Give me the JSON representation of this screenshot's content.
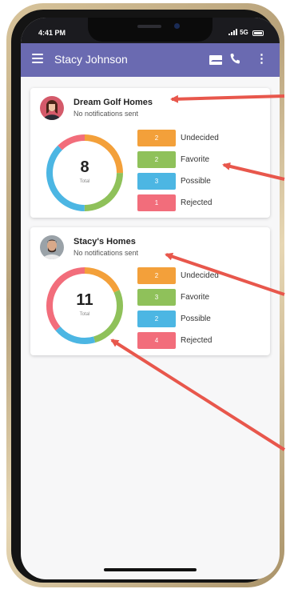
{
  "status_bar": {
    "time": "4:41 PM",
    "network": "5G"
  },
  "app_bar": {
    "title": "Stacy Johnson",
    "icons": [
      "menu-icon",
      "mail-icon",
      "phone-icon",
      "more-vert-icon"
    ]
  },
  "cards": [
    {
      "title": "Dream Golf Homes",
      "notification": "No notifications sent",
      "total": "8",
      "total_label": "Total",
      "statuses": [
        {
          "count": "2",
          "label": "Undecided",
          "color": "#f3a03a"
        },
        {
          "count": "2",
          "label": "Favorite",
          "color": "#8fc15a"
        },
        {
          "count": "3",
          "label": "Possible",
          "color": "#4cb6e3"
        },
        {
          "count": "1",
          "label": "Rejected",
          "color": "#f26d7b"
        }
      ]
    },
    {
      "title": "Stacy's Homes",
      "notification": "No notifications sent",
      "total": "11",
      "total_label": "Total",
      "statuses": [
        {
          "count": "2",
          "label": "Undecided",
          "color": "#f3a03a"
        },
        {
          "count": "3",
          "label": "Favorite",
          "color": "#8fc15a"
        },
        {
          "count": "2",
          "label": "Possible",
          "color": "#4cb6e3"
        },
        {
          "count": "4",
          "label": "Rejected",
          "color": "#f26d7b"
        }
      ]
    }
  ],
  "colors": {
    "app_bar": "#6a6ab1",
    "arrow": "#e8574c",
    "undecided": "#f3a03a",
    "favorite": "#8fc15a",
    "possible": "#4cb6e3",
    "rejected": "#f26d7b"
  }
}
